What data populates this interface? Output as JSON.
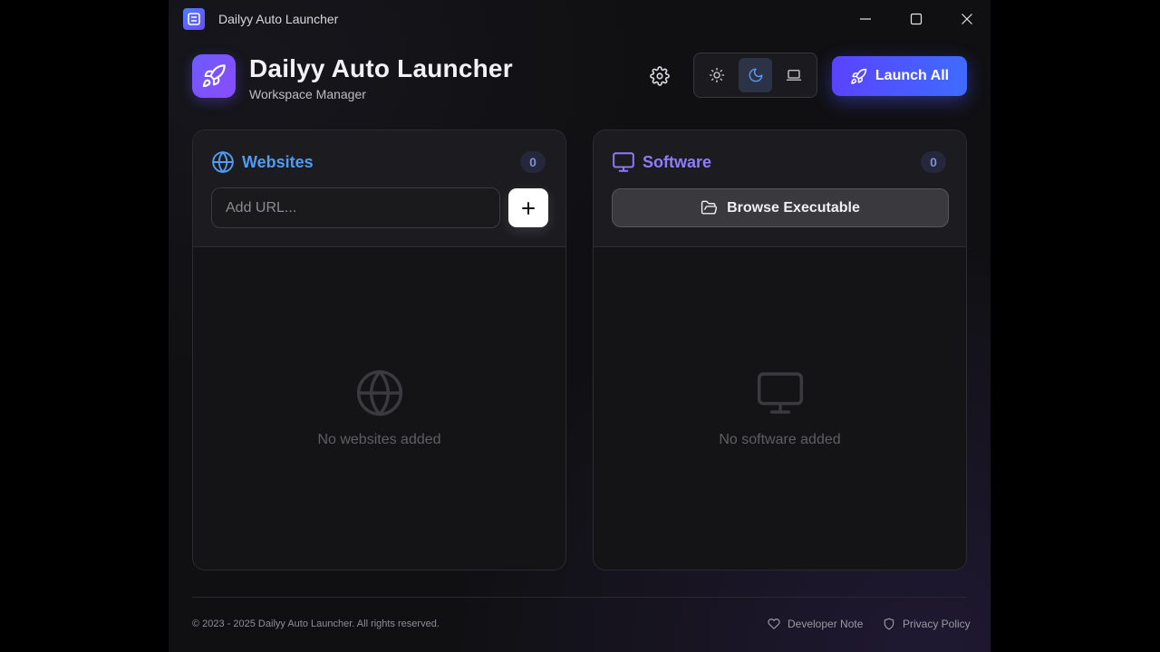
{
  "window": {
    "title": "Dailyy Auto Launcher",
    "controls": {
      "minimize": "minimize-icon",
      "maximize": "maximize-icon",
      "close": "close-icon"
    }
  },
  "header": {
    "title": "Dailyy Auto Launcher",
    "subtitle": "Workspace Manager",
    "settings_icon": "gear-icon",
    "theme_options": [
      {
        "name": "light",
        "icon": "sun-icon",
        "active": false
      },
      {
        "name": "dark",
        "icon": "moon-icon",
        "active": true
      },
      {
        "name": "system",
        "icon": "laptop-icon",
        "active": false
      }
    ],
    "launch_label": "Launch All"
  },
  "websites": {
    "title": "Websites",
    "count": "0",
    "input_placeholder": "Add URL...",
    "input_value": "",
    "empty_text": "No websites added"
  },
  "software": {
    "title": "Software",
    "count": "0",
    "browse_label": "Browse Executable",
    "empty_text": "No software added"
  },
  "footer": {
    "copyright": "© 2023 - 2025 Dailyy Auto Launcher. All rights reserved.",
    "developer_note": "Developer Note",
    "privacy_policy": "Privacy Policy"
  },
  "colors": {
    "accent_blue": "#4f9cf0",
    "accent_purple": "#8f7bff",
    "launch_gradient_start": "#5a43ff",
    "launch_gradient_end": "#3f6bff"
  }
}
